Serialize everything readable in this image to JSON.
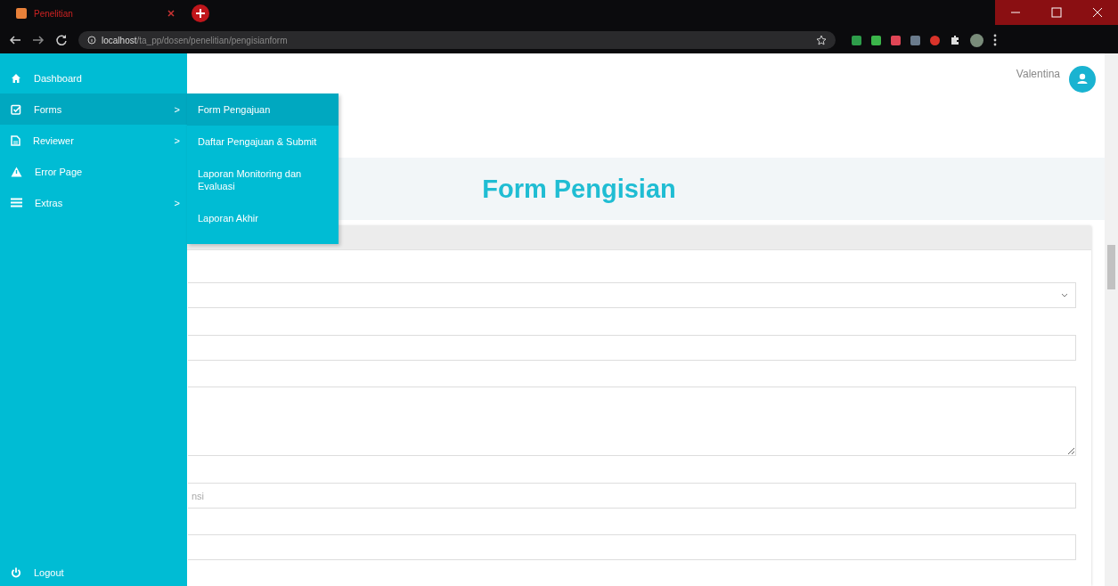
{
  "browser": {
    "tab_title": "Penelitian",
    "url_host": "localhost",
    "url_path": "/ta_pp/dosen/penelitian/pengisianform"
  },
  "user": {
    "name": "Valentina"
  },
  "sidebar": {
    "items": [
      {
        "label": "Dashboard",
        "selected": false,
        "has_submenu": false
      },
      {
        "label": "Forms",
        "selected": true,
        "has_submenu": true
      },
      {
        "label": "Reviewer",
        "selected": false,
        "has_submenu": true
      },
      {
        "label": "Error Page",
        "selected": false,
        "has_submenu": false
      },
      {
        "label": "Extras",
        "selected": false,
        "has_submenu": true
      }
    ],
    "submenu_caret": ">",
    "logout": "Logout"
  },
  "submenu": [
    {
      "label": "Form Pengajuan",
      "selected": true
    },
    {
      "label": "Daftar Pengajuan & Submit",
      "selected": false
    },
    {
      "label": "Laporan Monitoring dan Evaluasi",
      "selected": false
    },
    {
      "label": "Laporan Akhir",
      "selected": false
    }
  ],
  "page_title": "Form Pengisian",
  "fields": [
    {
      "kind": "select"
    },
    {
      "kind": "input"
    },
    {
      "kind": "textarea"
    },
    {
      "kind": "input",
      "placeholder": "nsi"
    },
    {
      "kind": "input"
    }
  ]
}
